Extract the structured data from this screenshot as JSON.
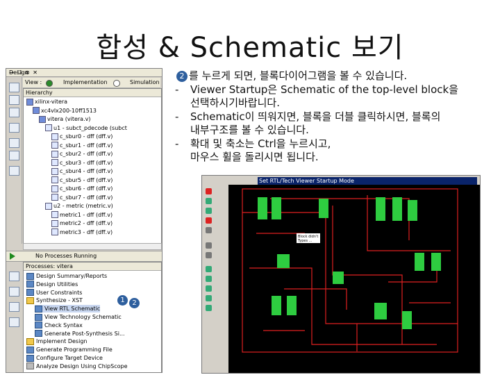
{
  "slide": {
    "title": "합성 & Schematic 보기"
  },
  "ise": {
    "panel_title": "Design",
    "window_controls": "→ ☐ ⊗ ✕",
    "view_label": "View :",
    "view_options": [
      "Implementation",
      "Simulation"
    ],
    "hierarchy_label": "Hierarchy",
    "hierarchy": [
      {
        "text": "xilinx-vitera",
        "indent": 0
      },
      {
        "text": "xc4vlx200-10ff1513",
        "indent": 1
      },
      {
        "text": "vitera (vitera.v)",
        "indent": 2
      },
      {
        "text": "u1 - subct_pdecode (subct",
        "indent": 3
      },
      {
        "text": "c_sbur0 - dff (dff.v)",
        "indent": 4
      },
      {
        "text": "c_sbur1 - dff (dff.v)",
        "indent": 4
      },
      {
        "text": "c_sbur2 - dff (dff.v)",
        "indent": 4
      },
      {
        "text": "c_sbur3 - dff (dff.v)",
        "indent": 4
      },
      {
        "text": "c_sbur4 - dff (dff.v)",
        "indent": 4
      },
      {
        "text": "c_sbur5 - dff (dff.v)",
        "indent": 4
      },
      {
        "text": "c_sbur6 - dff (dff.v)",
        "indent": 4
      },
      {
        "text": "c_sbur7 - dff (dff.v)",
        "indent": 4
      },
      {
        "text": "u2 - metric (metric.v)",
        "indent": 3
      },
      {
        "text": "metric1 - dff (dff.v)",
        "indent": 4
      },
      {
        "text": "metric2 - dff (dff.v)",
        "indent": 4
      },
      {
        "text": "metric3 - dff (dff.v)",
        "indent": 4
      }
    ],
    "process_status": "No Processes Running",
    "processes_label": "Processes: vitera",
    "processes": [
      {
        "text": "Design Summary/Reports",
        "indent": 0,
        "icon": "blue"
      },
      {
        "text": "Design Utilities",
        "indent": 0,
        "icon": "blue"
      },
      {
        "text": "User Constraints",
        "indent": 0,
        "icon": "blue"
      },
      {
        "text": "Synthesize - XST",
        "indent": 0,
        "icon": "yellow"
      },
      {
        "text": "View RTL Schematic",
        "indent": 1,
        "icon": "blue",
        "selected": true
      },
      {
        "text": "View Technology Schematic",
        "indent": 1,
        "icon": "blue"
      },
      {
        "text": "Check Syntax",
        "indent": 1,
        "icon": "blue"
      },
      {
        "text": "Generate Post-Synthesis Si...",
        "indent": 1,
        "icon": "blue"
      },
      {
        "text": "Implement Design",
        "indent": 0,
        "icon": "yellow"
      },
      {
        "text": "Generate Programming File",
        "indent": 0,
        "icon": "blue"
      },
      {
        "text": "Configure Target Device",
        "indent": 0,
        "icon": "blue"
      },
      {
        "text": "Analyze Design Using ChipScope",
        "indent": 0,
        "icon": "gray"
      }
    ],
    "badge1": "1",
    "badge2": "2"
  },
  "bullets": {
    "intro_badge": "2",
    "intro": "를 누르게 되면, 블록다이어그램을 볼 수 있습니다.",
    "items": [
      {
        "line1": "Viewer Startup은 Schematic of the top-level block을",
        "line2": "선택하시기바랍니다."
      },
      {
        "line1": "Schematic이 띄워지면, 블록을 더블 클릭하시면, 블록의",
        "line2": "내부구조를 볼 수 있습니다."
      },
      {
        "line1": "확대 및 축소는 Ctrl을 누르시고,",
        "line2": "마우스 휠을 돌리시면 됩니다."
      }
    ],
    "dash": "-"
  },
  "viewer": {
    "title": "Set RTL/Tech Viewer Startup Mode",
    "block_label_1": "Block didn't",
    "block_label_2": "Types ...",
    "colors": {
      "canvas": "#000000",
      "wire": "#e02020",
      "block": "#2ecc40"
    }
  }
}
